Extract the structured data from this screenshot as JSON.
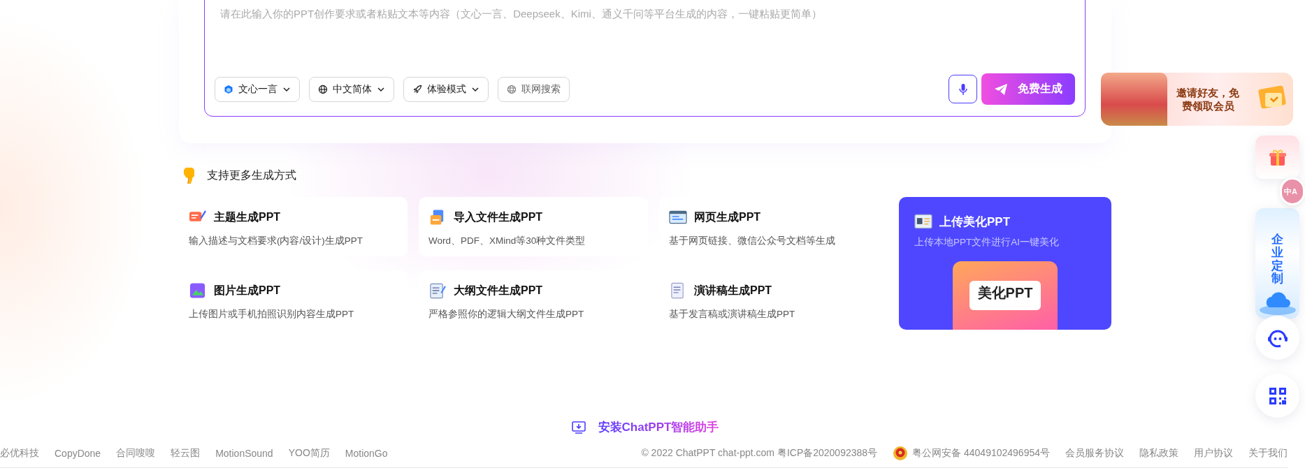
{
  "prompt": {
    "placeholder": "请在此输入你的PPT创作要求或者粘贴文本等内容（文心一言、Deepseek、Kimi、通义千问等平台生成的内容，一键粘贴更简单）"
  },
  "toolbar": [
    {
      "kind": "dropdown",
      "label": "文心一言"
    },
    {
      "kind": "dropdown",
      "label": "中文简体"
    },
    {
      "kind": "dropdown",
      "label": "体验模式"
    },
    {
      "kind": "toggle",
      "label": "联网搜索",
      "on": false
    }
  ],
  "generate_button": {
    "label": "免费生成"
  },
  "more_section": {
    "title": "支持更多生成方式",
    "cards": [
      {
        "title": "主题生成PPT",
        "description": "输入描述与文档要求(内容/设计)生成PPT",
        "featured": false
      },
      {
        "title": "导入文件生成PPT",
        "description": "Word、PDF、XMind等30种文件类型",
        "featured": false
      },
      {
        "title": "网页生成PPT",
        "description": "基于网页链接、微信公众号文档等生成",
        "featured": false
      },
      {
        "title": "上传美化PPT",
        "description": "上传本地PPT文件进行AI一键美化",
        "featured": true,
        "art_label": "美化PPT"
      },
      {
        "title": "图片生成PPT",
        "description": "上传图片或手机拍照识别内容生成PPT",
        "featured": false
      },
      {
        "title": "大纲文件生成PPT",
        "description": "严格参照你的逻辑大纲文件生成PPT",
        "featured": false
      },
      {
        "title": "演讲稿生成PPT",
        "description": "基于发言稿或演讲稿生成PPT",
        "featured": false
      }
    ]
  },
  "install_link": "安装ChatPPT智能助手",
  "footer": {
    "left_links": [
      "必优科技",
      "CopyDone",
      "合同嗖嗖",
      "轻云图",
      "MotionSound",
      "YOO简历",
      "MotionGo"
    ],
    "copyright": "© 2022 ChatPPT chat-ppt.com 粤ICP备2020092388号",
    "police_record": "粤公网安备 44049102496954号",
    "right_links": [
      "会员服务协议",
      "隐私政策",
      "用户协议",
      "关于我们"
    ]
  },
  "floating": {
    "invite_banner": "邀请好友，免费领取会员",
    "translate_label": "中A",
    "enterprise": "企业定制"
  }
}
